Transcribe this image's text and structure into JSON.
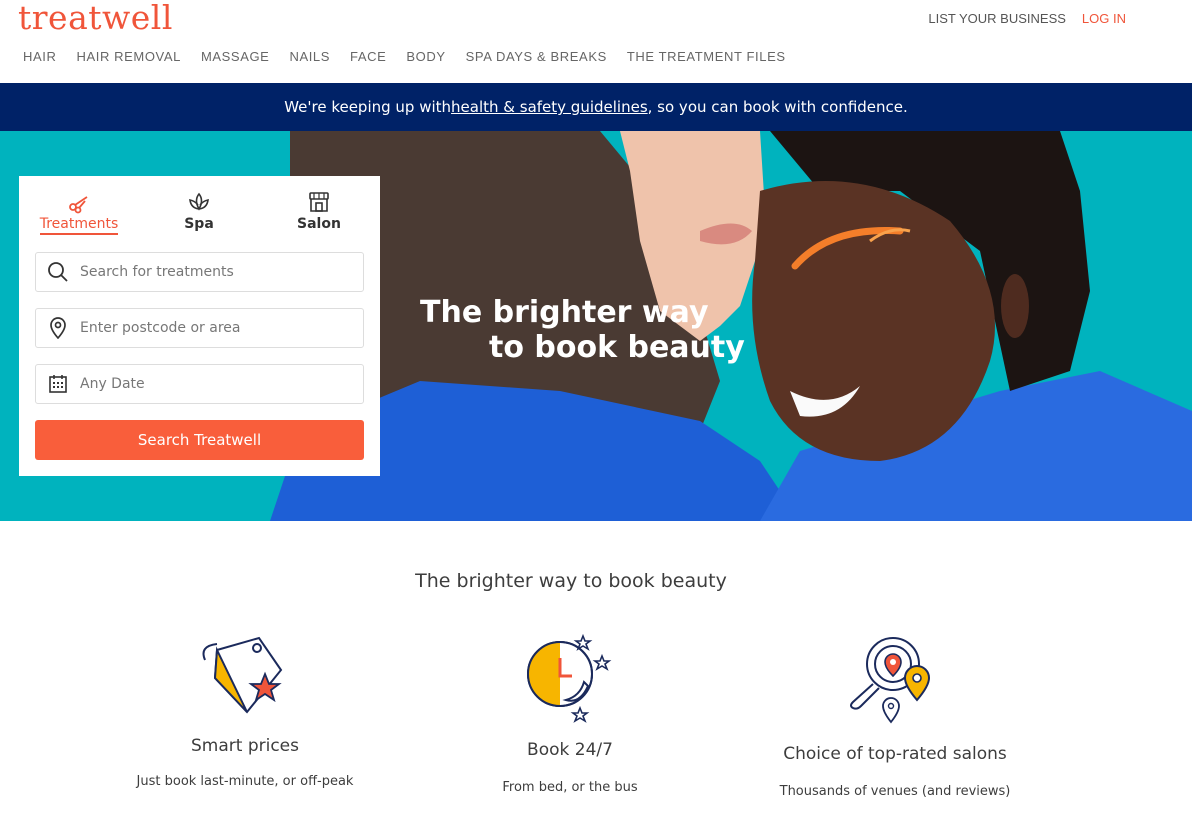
{
  "brand": {
    "logo": "treatwell",
    "accent": "#f0553a",
    "navy": "#002267",
    "teal": "#00b3be"
  },
  "toplinks": {
    "list_business": "LIST YOUR BUSINESS",
    "login": "LOG IN"
  },
  "nav": [
    "HAIR",
    "HAIR REMOVAL",
    "MASSAGE",
    "NAILS",
    "FACE",
    "BODY",
    "SPA DAYS & BREAKS",
    "THE TREATMENT FILES"
  ],
  "banner": {
    "before": "We're keeping up with ",
    "link": "health & safety guidelines",
    "after": ", so you can book with confidence."
  },
  "hero": {
    "line1": "The brighter way",
    "line2": "to book beauty"
  },
  "search": {
    "tabs": [
      {
        "label": "Treatments",
        "icon": "scissors-icon",
        "active": true
      },
      {
        "label": "Spa",
        "icon": "lotus-icon",
        "active": false
      },
      {
        "label": "Salon",
        "icon": "shop-icon",
        "active": false
      }
    ],
    "treatment_placeholder": "Search for treatments",
    "location_placeholder": "Enter postcode or area",
    "date_placeholder": "Any Date",
    "button": "Search Treatwell"
  },
  "features": {
    "title": "The brighter way to book beauty",
    "items": [
      {
        "title": "Smart prices",
        "subtitle": "Just book last-minute, or off-peak",
        "icon": "price-tag-star-icon"
      },
      {
        "title": "Book 24/7",
        "subtitle": "From bed, or the bus",
        "icon": "clock-moon-icon"
      },
      {
        "title": "Choice of top-rated salons",
        "subtitle": "Thousands of venues (and reviews)",
        "icon": "magnifier-pin-icon"
      }
    ]
  }
}
